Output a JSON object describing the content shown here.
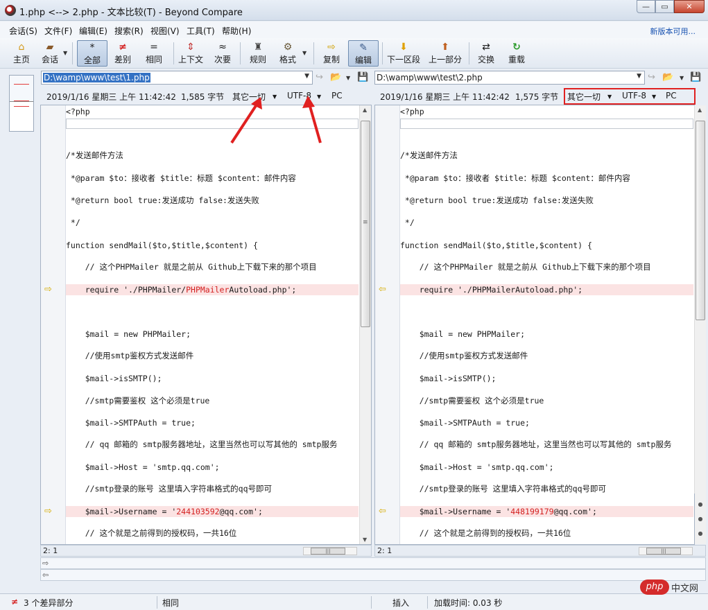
{
  "window": {
    "title": "1.php <--> 2.php - 文本比较(T) - Beyond Compare",
    "buttons": [
      "—",
      "▭",
      "✕"
    ]
  },
  "menu": {
    "items": [
      "会话(S)",
      "文件(F)",
      "编辑(E)",
      "搜索(R)",
      "视图(V)",
      "工具(T)",
      "帮助(H)"
    ],
    "new_version": "新版本可用..."
  },
  "toolbar": {
    "home": "主页",
    "session": "会话",
    "all": "全部",
    "diffs": "差别",
    "same": "相同",
    "context": "上下文",
    "minor": "次要",
    "rules": "规则",
    "format": "格式",
    "copy": "复制",
    "edit": "编辑",
    "next_section": "下一区段",
    "prev_section": "上一部分",
    "swap": "交换",
    "reload": "重载"
  },
  "left": {
    "path": "D:\\wamp\\www\\test\\1.php",
    "date": "2019/1/16 星期三 上午 11:42:42",
    "size": "1,585 字节",
    "filter": "其它一切",
    "encoding": "UTF-8",
    "lineend": "PC",
    "position": "2: 1"
  },
  "right": {
    "path": "D:\\wamp\\www\\test\\2.php",
    "date": "2019/1/16 星期三 上午 11:42:42",
    "size": "1,575 字节",
    "filter": "其它一切",
    "encoding": "UTF-8",
    "lineend": "PC",
    "position": "2: 1"
  },
  "code": {
    "l0": "<?php",
    "l1": "/*发送邮件方法",
    "l2": " *@param $to：接收者 $title：标题 $content：邮件内容",
    "l3": " *@return bool true:发送成功 false:发送失败",
    "l4": " */",
    "l5": "function sendMail($to,$title,$content) {",
    "l6": "    // 这个PHPMailer 就是之前从 Github上下载下来的那个项目",
    "l7_pre": "    require './PHPMailer/",
    "l7_red": "PHPMailer",
    "l7_post": "Autoload.php';",
    "r7": "    require './PHPMailerAutoload.php';",
    "l8": "    $mail = new PHPMailer;",
    "l9": "    //使用smtp鉴权方式发送邮件",
    "l10": "    $mail->isSMTP();",
    "l11": "    //smtp需要鉴权 这个必须是true",
    "l12": "    $mail->SMTPAuth = true;",
    "l13": "    // qq 邮箱的 smtp服务器地址，这里当然也可以写其他的 smtp服务",
    "l14": "    $mail->Host = 'smtp.qq.com';",
    "l15": "    //smtp登录的账号 这里填入字符串格式的qq号即可",
    "l16_pre": "    $mail->Username = '",
    "l16_red": "244103592",
    "l16_post": "@qq.com';",
    "r16_pre": "    $mail->Username = '",
    "r16_red": "448199179",
    "r16_post": "@qq.com';",
    "l17": "    // 这个就是之前得到的授权码，一共16位"
  },
  "status": {
    "diff_count": "3 个差异部分",
    "same": "相同",
    "insert": "插入",
    "load_time": "加载时间: 0.03 秒"
  },
  "watermark": {
    "logo": "php",
    "text": "中文网"
  },
  "colors": {
    "diff_bg": "#fbe3e3",
    "diff_text": "#d42020",
    "highlight_box": "#e02020",
    "selection": "#3472c4"
  }
}
